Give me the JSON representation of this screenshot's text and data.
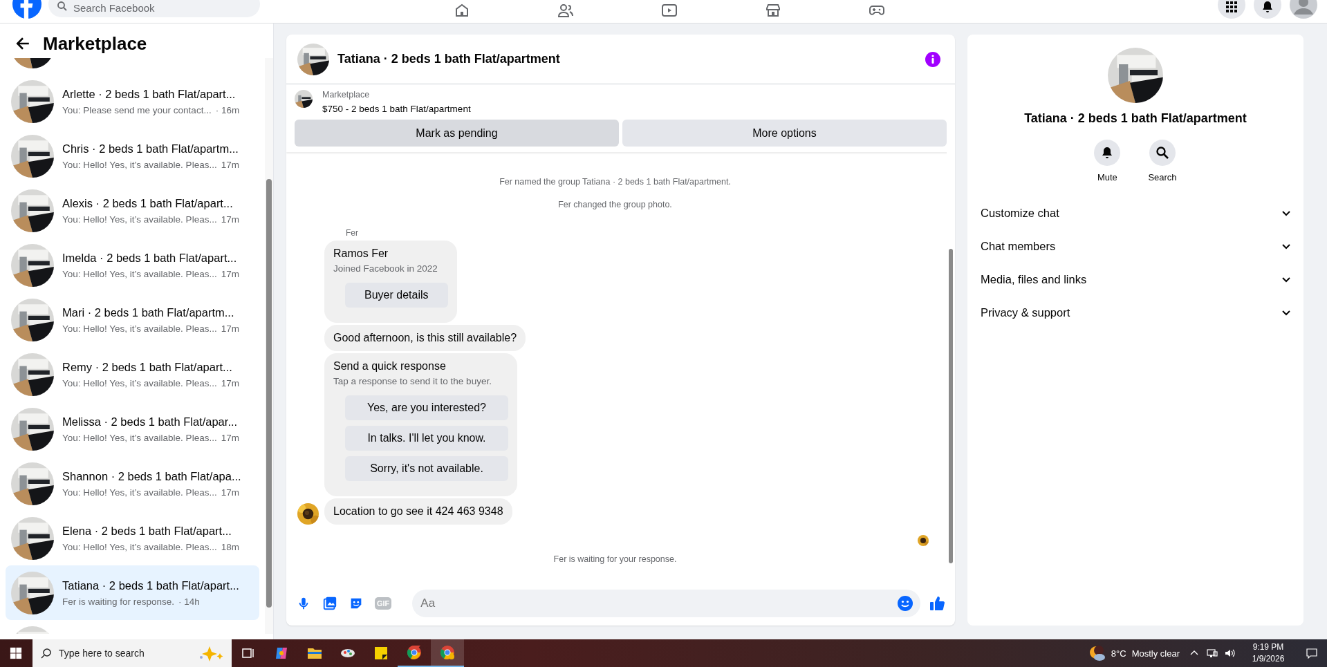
{
  "topbar": {
    "search_placeholder": "Search Facebook"
  },
  "sidebar": {
    "title": "Marketplace",
    "conversations": [
      {
        "title": "Arlette · 2 beds 1 bath Flat/apart...",
        "preview": "You: Please send me your contact...",
        "time": "· 16m",
        "selected": false
      },
      {
        "title": "Chris · 2 beds 1 bath Flat/apartm...",
        "preview": "You: Hello! Yes, it’s available. Pleas...",
        "time": "17m",
        "selected": false
      },
      {
        "title": "Alexis · 2 beds 1 bath Flat/apart...",
        "preview": "You: Hello! Yes, it’s available. Pleas...",
        "time": "17m",
        "selected": false
      },
      {
        "title": "Imelda · 2 beds 1 bath Flat/apart...",
        "preview": "You: Hello! Yes, it’s available. Pleas...",
        "time": "17m",
        "selected": false
      },
      {
        "title": "Mari · 2 beds 1 bath Flat/apartm...",
        "preview": "You: Hello! Yes, it’s available. Pleas...",
        "time": "17m",
        "selected": false
      },
      {
        "title": "Remy · 2 beds 1 bath Flat/apart...",
        "preview": "You: Hello! Yes, it’s available. Pleas...",
        "time": "17m",
        "selected": false
      },
      {
        "title": "Melissa · 2 beds 1 bath Flat/apar...",
        "preview": "You: Hello! Yes, it’s available. Pleas...",
        "time": "17m",
        "selected": false
      },
      {
        "title": "Shannon · 2 beds 1 bath Flat/apa...",
        "preview": "You: Hello! Yes, it’s available. Pleas...",
        "time": "17m",
        "selected": false
      },
      {
        "title": "Elena · 2 beds 1 bath Flat/apart...",
        "preview": "You: Hello! Yes, it’s available. Pleas...",
        "time": "18m",
        "selected": false
      },
      {
        "title": "Tatiana · 2 beds 1 bath Flat/apart...",
        "preview": "Fer is waiting for response.",
        "time": "· 14h",
        "selected": true
      }
    ]
  },
  "chat": {
    "title": "Tatiana · 2 beds 1 bath Flat/apartment",
    "listing": {
      "source": "Marketplace",
      "price_title": "$750 - 2 beds 1 bath Flat/apartment",
      "buttons": [
        "Mark as pending",
        "More options"
      ]
    },
    "messages": [
      {
        "kind": "system",
        "text": "Fer named the group Tatiana · 2 beds 1 bath Flat/apartment."
      },
      {
        "kind": "system",
        "text": "Fer changed the group photo."
      },
      {
        "kind": "sender",
        "text": "Fer"
      },
      {
        "kind": "buyer_card",
        "name": "Ramos Fer",
        "subtitle": "Joined Facebook in 2022",
        "button": "Buyer details"
      },
      {
        "kind": "text",
        "text": "Good afternoon, is this still available?",
        "avatar": false
      },
      {
        "kind": "quick_response",
        "title": "Send a quick response",
        "subtitle": "Tap a response to send it to the buyer.",
        "options": [
          "Yes, are you interested?",
          "In talks. I'll let you know.",
          "Sorry, it's not available."
        ]
      },
      {
        "kind": "text",
        "text": "Location to go see it 424 463 9348",
        "avatar": true
      },
      {
        "kind": "seen"
      },
      {
        "kind": "waiting",
        "text": "Fer is waiting for your response."
      }
    ],
    "composer": {
      "placeholder": "Aa",
      "gif_label": "GIF"
    }
  },
  "info_panel": {
    "title": "Tatiana · 2 beds 1 bath Flat/apartment",
    "actions": [
      {
        "kind": "mute",
        "label": "Mute"
      },
      {
        "kind": "search",
        "label": "Search"
      }
    ],
    "sections": [
      {
        "label": "Customize chat",
        "expanded": false
      },
      {
        "label": "Chat members",
        "expanded": false
      },
      {
        "label": "Media, files and links",
        "expanded": false
      },
      {
        "label": "Privacy & support",
        "expanded": false
      }
    ]
  },
  "taskbar": {
    "search_placeholder": "Type here to search",
    "temperature": "8°C",
    "weather": "Mostly clear",
    "time": "9:19 PM",
    "date": "1/9/2026"
  }
}
